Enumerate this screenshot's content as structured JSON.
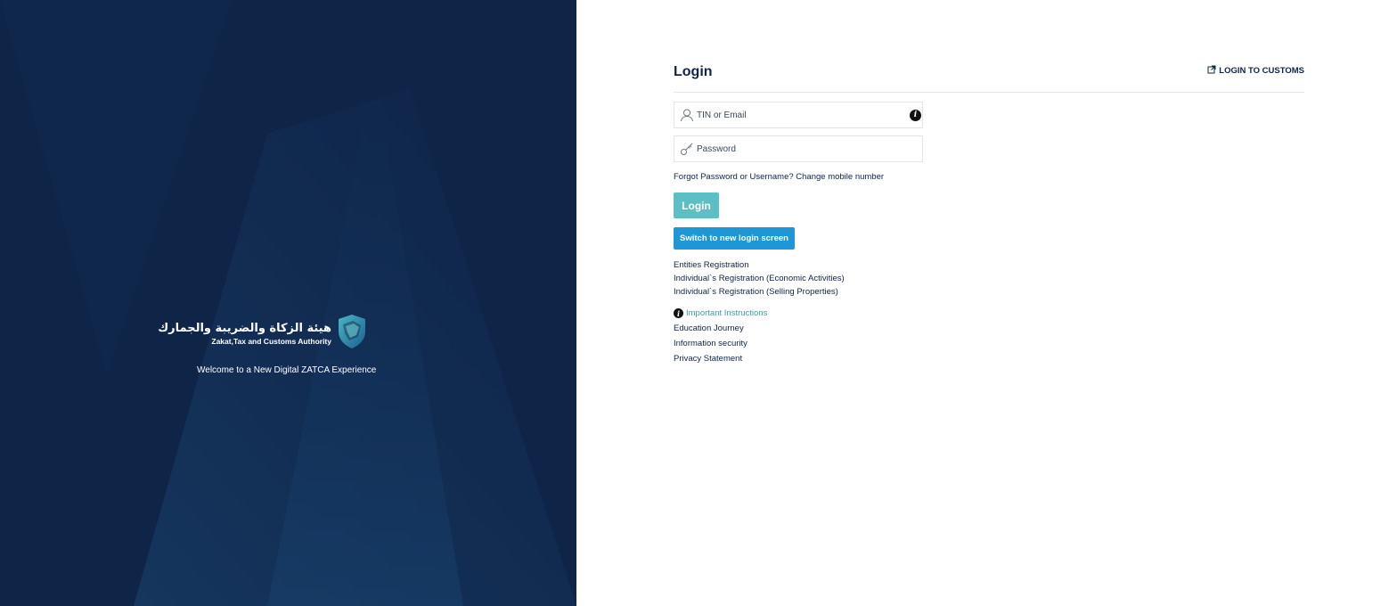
{
  "brand": {
    "arabic_name": "هيئة الزكاة والضريبة والجمارك",
    "english_name": "Zakat,Tax and Customs Authority",
    "welcome": "Welcome to a New Digital ZATCA Experience",
    "panel_color": "#0f2548"
  },
  "login": {
    "title": "Login",
    "customs_link": "LOGIN TO CUSTOMS",
    "username_placeholder": "TIN or Email",
    "password_placeholder": "Password",
    "forgot_text": "Forgot Password or Username?",
    "change_mobile": "Change mobile number",
    "login_button": "Login",
    "switch_button": "Switch to new login screen"
  },
  "registration_links": [
    "Entities Registration",
    "Individual`s Registration (Economic Activities)",
    "Individual`s Registration (Selling Properties)"
  ],
  "important_instructions": "Important Instructions",
  "info_links": [
    "Education Journey",
    "Information security",
    "Privacy Statement"
  ],
  "colors": {
    "login_button": "#5cbfc4",
    "switch_button": "#1e97d7",
    "link": "#0f2548",
    "instructions_link": "#2aa6b3"
  },
  "icons": {
    "username": "user-icon",
    "password": "key-icon",
    "info": "info-icon",
    "external": "external-link-icon",
    "logo": "zatca-shield-logo"
  }
}
